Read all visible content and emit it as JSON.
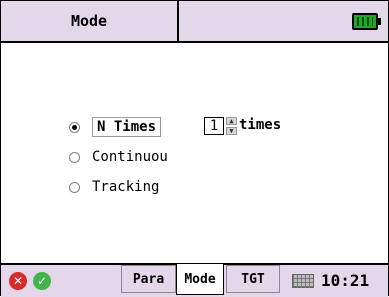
{
  "header": {
    "title": "Mode"
  },
  "mode_options": {
    "n_times": {
      "label": "N Times",
      "selected": true
    },
    "continuous": {
      "label": "Continuou",
      "selected": false
    },
    "tracking": {
      "label": "Tracking",
      "selected": false
    }
  },
  "times": {
    "value": "1",
    "unit": "times"
  },
  "bottom": {
    "tabs": [
      {
        "label": "Para",
        "active": false
      },
      {
        "label": "Mode",
        "active": true
      },
      {
        "label": "TGT",
        "active": false
      }
    ],
    "time": "10:21"
  },
  "colors": {
    "header_bg": "#e2d8ea",
    "battery": "#1fa823",
    "close_button": "#d52b2b",
    "ok_button": "#42b54a"
  },
  "icons": {
    "battery": "battery-icon",
    "close": "close-icon",
    "ok": "check-icon",
    "keyboard": "keyboard-icon"
  }
}
